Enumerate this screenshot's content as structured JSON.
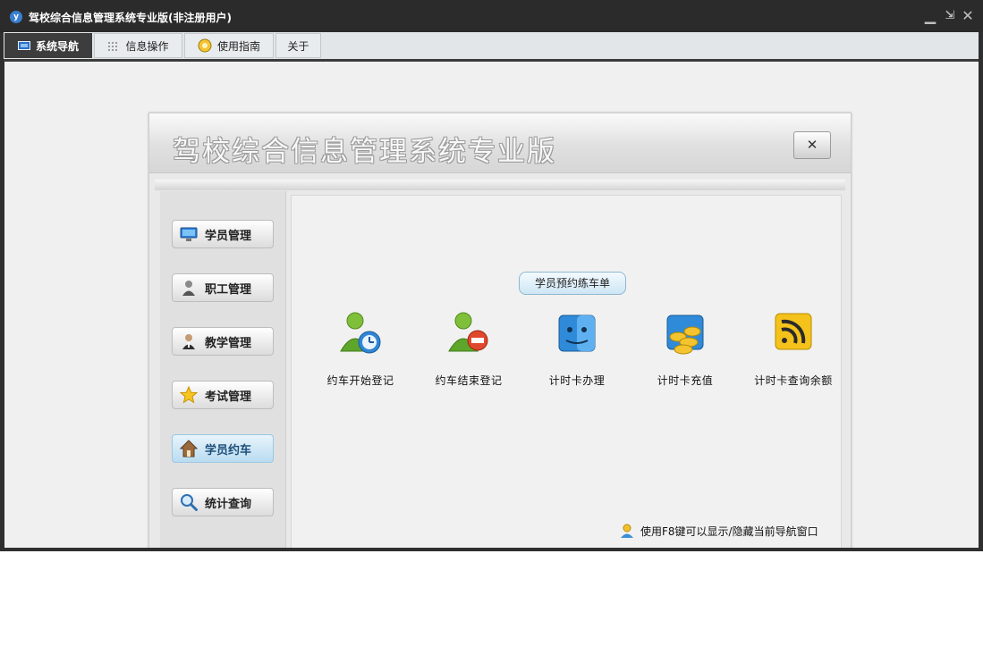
{
  "window": {
    "title": "驾校综合信息管理系统专业版(非注册用户)",
    "controls": {
      "minimize": "▁",
      "restore": "⇲",
      "close": "✕"
    }
  },
  "tabs": [
    {
      "label": "系统导航",
      "icon": "monitor-icon",
      "active": true
    },
    {
      "label": "信息操作",
      "icon": "grid-icon",
      "active": false
    },
    {
      "label": "使用指南",
      "icon": "help-icon",
      "active": false
    },
    {
      "label": "关于",
      "icon": "",
      "active": false
    }
  ],
  "panel": {
    "title": "驾校综合信息管理系统专业版",
    "close_label": "✕",
    "side_menu": [
      {
        "label": "学员管理",
        "icon": "monitor-icon",
        "active": false
      },
      {
        "label": "职工管理",
        "icon": "person-icon",
        "active": false
      },
      {
        "label": "教学管理",
        "icon": "teacher-icon",
        "active": false
      },
      {
        "label": "考试管理",
        "icon": "star-icon",
        "active": false
      },
      {
        "label": "学员约车",
        "icon": "home-icon",
        "active": true
      },
      {
        "label": "统计查询",
        "icon": "search-icon",
        "active": false
      }
    ],
    "section_title": "学员预约练车单",
    "features": [
      {
        "label": "约车开始登记",
        "icon": "user-clock-icon"
      },
      {
        "label": "约车结束登记",
        "icon": "user-stop-icon"
      },
      {
        "label": "计时卡办理",
        "icon": "finder-icon"
      },
      {
        "label": "计时卡充值",
        "icon": "coins-icon"
      },
      {
        "label": "计时卡查询余额",
        "icon": "rss-icon"
      }
    ],
    "hint": "使用F8键可以显示/隐藏当前导航窗口"
  },
  "colors": {
    "titlebar": "#2b2b2b",
    "active_tab": "#3d3d3d",
    "active_side_button": "#b9dcf1"
  }
}
